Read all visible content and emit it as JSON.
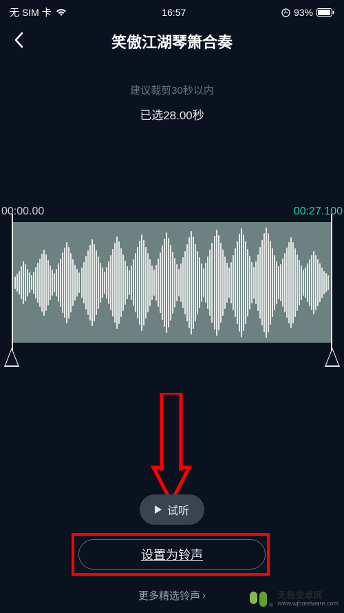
{
  "statusBar": {
    "simLabel": "无 SIM 卡",
    "time": "16:57",
    "batteryPercent": "93%"
  },
  "nav": {
    "title": "笑傲江湖琴箫合奏"
  },
  "hint": "建议裁剪30秒以内",
  "selectedDuration": "已选28.00秒",
  "timestamps": {
    "start": "00:00.00",
    "end": "00:27.100"
  },
  "previewLabel": "试听",
  "setRingtoneLabel": "设置为铃声",
  "moreLabel": "更多精选铃声",
  "watermark": {
    "cn": "无极安卓网",
    "en": "www.wjhotelware.com"
  }
}
